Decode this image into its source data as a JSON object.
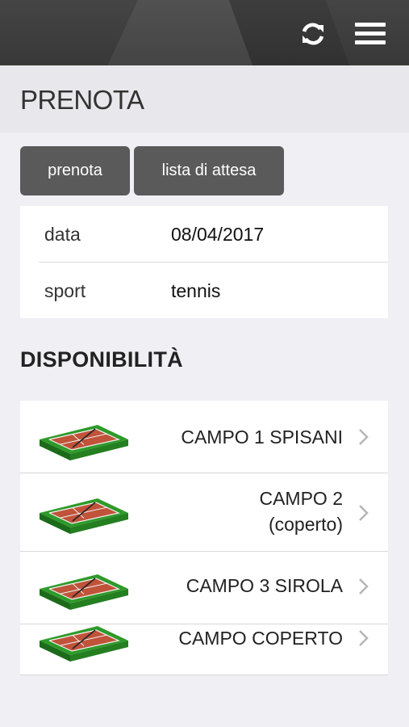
{
  "header": {
    "refresh_icon": "refresh-icon",
    "menu_icon": "hamburger-menu-icon",
    "background_color": "#3d3d3d"
  },
  "page": {
    "title": "PRENOTA"
  },
  "tabs": {
    "prenota": "prenota",
    "lista_attesa": "lista di attesa"
  },
  "info": {
    "data_label": "data",
    "data_value": "08/04/2017",
    "sport_label": "sport",
    "sport_value": "tennis"
  },
  "availability": {
    "title": "DISPONIBILITÀ",
    "courts": [
      {
        "line1": "CAMPO 1 SPISANI",
        "line2": ""
      },
      {
        "line1": "CAMPO 2",
        "line2": "(coperto)"
      },
      {
        "line1": "CAMPO 3 SIROLA",
        "line2": ""
      },
      {
        "line1": "CAMPO COPERTO",
        "line2": ""
      }
    ],
    "court_icon": "tennis-court-icon",
    "chevron_icon": "chevron-right-icon"
  }
}
